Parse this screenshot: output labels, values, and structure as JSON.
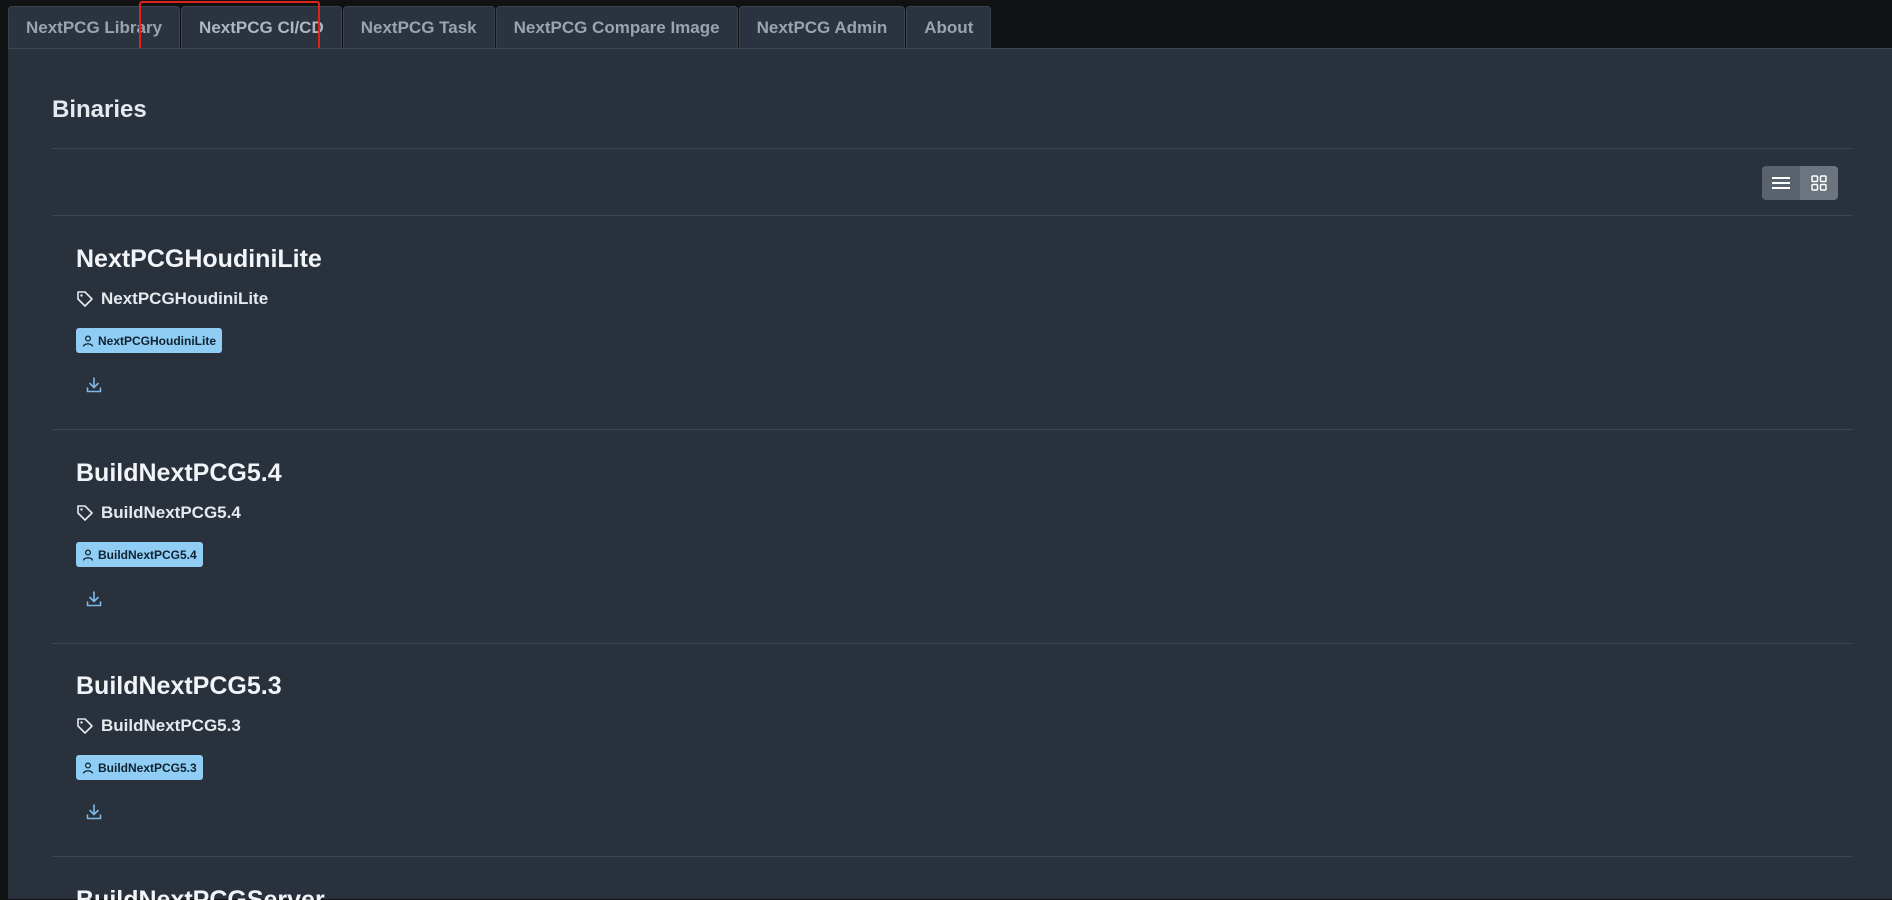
{
  "tabs": [
    {
      "label": "NextPCG Library"
    },
    {
      "label": "NextPCG CI/CD"
    },
    {
      "label": "NextPCG Task"
    },
    {
      "label": "NextPCG Compare Image"
    },
    {
      "label": "NextPCG Admin"
    },
    {
      "label": "About"
    }
  ],
  "active_tab": "NextPCG CI/CD",
  "page": {
    "title": "Binaries"
  },
  "view_toggle": {
    "options": [
      {
        "icon": "list-icon"
      },
      {
        "icon": "grid-icon"
      }
    ],
    "selected": "grid"
  },
  "items": [
    {
      "title": "NextPCGHoudiniLite",
      "tag": "NextPCGHoudiniLite",
      "badge": "NextPCGHoudiniLite"
    },
    {
      "title": "BuildNextPCG5.4",
      "tag": "BuildNextPCG5.4",
      "badge": "BuildNextPCG5.4"
    },
    {
      "title": "BuildNextPCG5.3",
      "tag": "BuildNextPCG5.3",
      "badge": "BuildNextPCG5.3"
    },
    {
      "title": "BuildNextPCGServer"
    }
  ],
  "colors": {
    "background": "#29313d",
    "badge": "#8fcdf5",
    "highlight": "#e0221c",
    "download_icon": "#7db9e8"
  }
}
